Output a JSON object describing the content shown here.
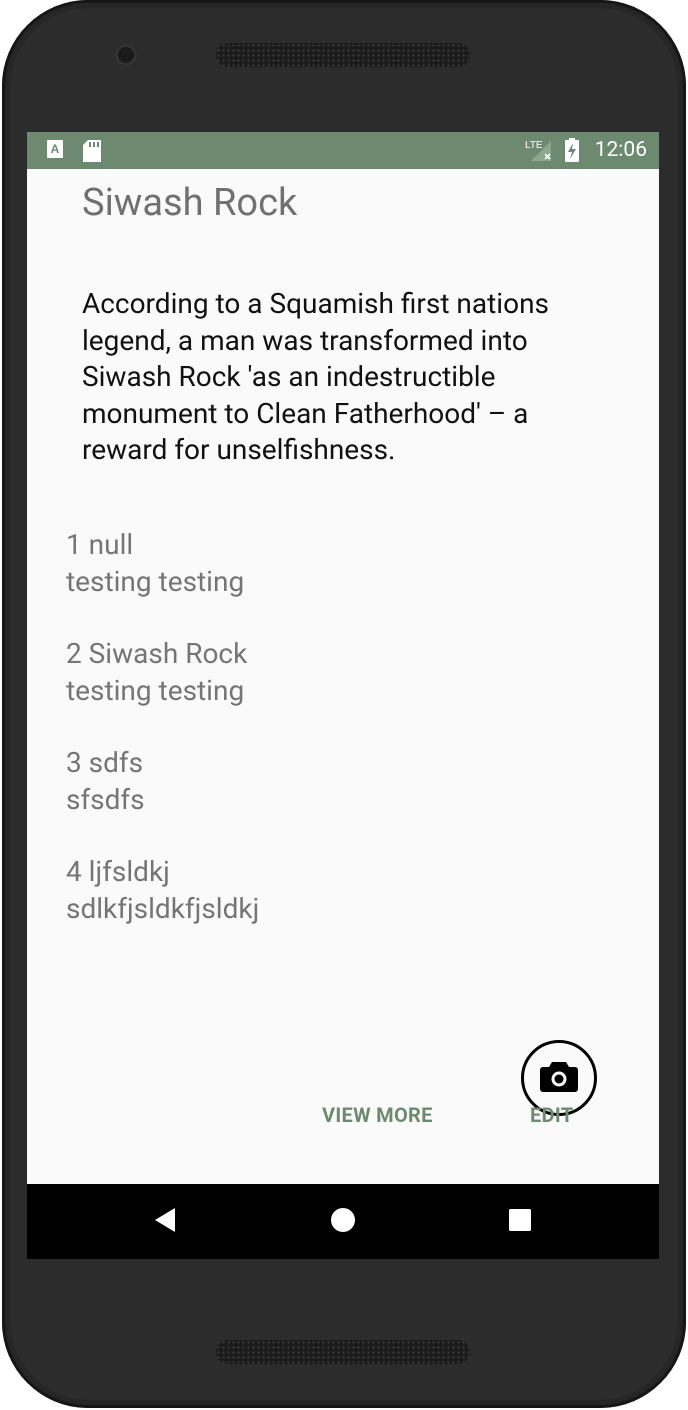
{
  "statusbar": {
    "time": "12:06",
    "network_label": "LTE",
    "icons": [
      "a-notification-icon",
      "sd-card-icon",
      "lte-signal-icon",
      "battery-charging-icon"
    ]
  },
  "place": {
    "title": "Siwash Rock",
    "description": "According to a Squamish first nations legend, a man was transformed into Siwash Rock 'as an indestructible monument to Clean Fatherhood' – a reward for unselfishness."
  },
  "comments": [
    {
      "heading": "1 null",
      "body": "testing testing"
    },
    {
      "heading": "2 Siwash Rock",
      "body": "testing testing"
    },
    {
      "heading": "3 sdfs",
      "body": "sfsdfs"
    },
    {
      "heading": "4 ljfsldkj",
      "body": "sdlkfjsldkfjsldkj"
    }
  ],
  "actions": {
    "camera_icon": "camera-icon",
    "view_more_label": "VIEW MORE",
    "edit_label": "EDIT"
  },
  "navbar": {
    "icons": [
      "back-icon",
      "home-icon",
      "recents-icon"
    ]
  },
  "colors": {
    "accent": "#6d8a70",
    "statusbar": "#6d8a70",
    "background": "#fafafa"
  }
}
